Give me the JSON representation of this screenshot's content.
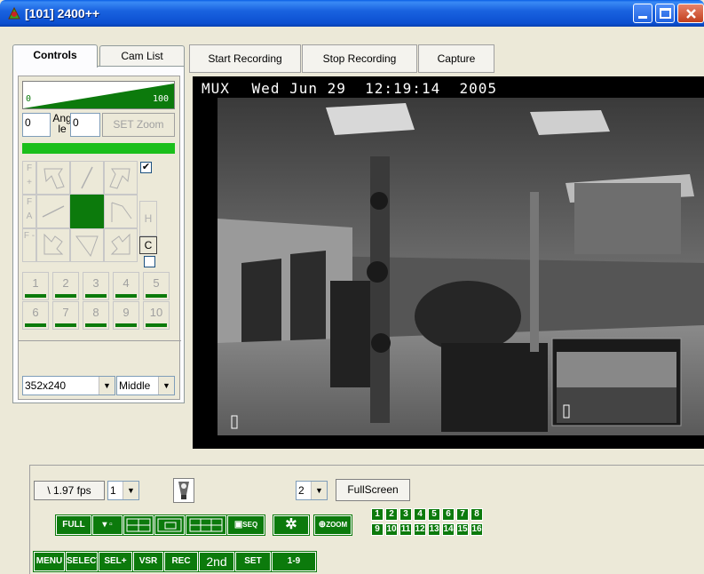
{
  "window": {
    "title": "[101] 2400++"
  },
  "tabs": {
    "controls": "Controls",
    "cam_list": "Cam List"
  },
  "controls": {
    "meter_min": "0",
    "meter_max": "100",
    "angle_value_1": "0",
    "angle_label": "Angle",
    "angle_value_2": "0",
    "set_zoom": "SET Zoom",
    "ptz": {
      "f_plus": "F +",
      "f_a": "F A",
      "f_minus": "F -",
      "h_label": "H",
      "c_label": "C",
      "checkbox_checked": true
    },
    "presets": [
      "1",
      "2",
      "3",
      "4",
      "5",
      "6",
      "7",
      "8",
      "9",
      "10"
    ],
    "resolution": "352x240",
    "quality": "Middle"
  },
  "toolbar": {
    "start_recording": "Start Recording",
    "stop_recording": "Stop Recording",
    "capture": "Capture"
  },
  "video": {
    "osd_label": "MUX",
    "osd_datetime": "Wed Jun 29  12:19:14  2005"
  },
  "bottom": {
    "fps": "\\ 1.97 fps",
    "fps_select": "1",
    "split_select": "2",
    "fullscreen": "FullScreen",
    "buttons_row1": [
      "FULL",
      "",
      "",
      "",
      "",
      "SEQ",
      "",
      "ZOOM"
    ],
    "buttons_row2": [
      "MENU",
      "SELECT",
      "SEL+",
      "VSR",
      "REC",
      "2nd",
      "SET",
      "1-9"
    ],
    "channels": [
      "1",
      "2",
      "3",
      "4",
      "5",
      "6",
      "7",
      "8",
      "9",
      "10",
      "11",
      "12",
      "13",
      "14",
      "15",
      "16"
    ]
  },
  "colors": {
    "accent_green": "#0c7a0c",
    "bright_green": "#1bbf1b",
    "title_blue": "#0b4fd0"
  }
}
